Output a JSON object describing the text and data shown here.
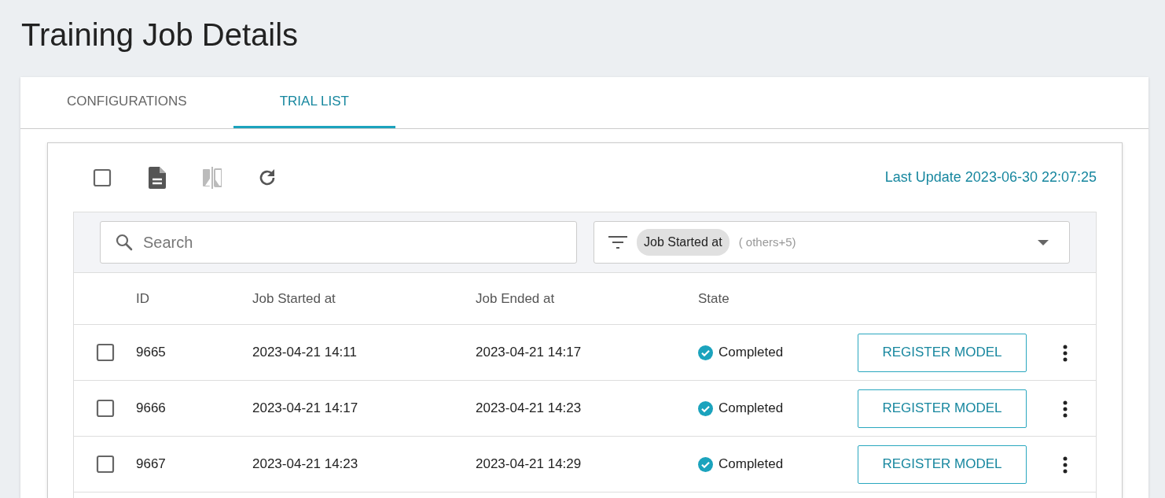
{
  "page": {
    "title": "Training Job Details"
  },
  "tabs": [
    {
      "label": "CONFIGURATIONS",
      "selected": false
    },
    {
      "label": "TRIAL LIST",
      "selected": true
    }
  ],
  "toolbar": [
    {
      "kind": "checkbox",
      "checked": false
    },
    {
      "kind": "document",
      "disabled": false
    },
    {
      "kind": "compare",
      "disabled": true
    },
    {
      "kind": "refresh",
      "disabled": false
    }
  ],
  "last_update": "Last Update 2023-06-30 22:07:25",
  "search": {
    "placeholder": "Search"
  },
  "filter": {
    "chip": "Job Started at",
    "others": "( others+5)"
  },
  "table": {
    "columns": [
      "ID",
      "Job Started at",
      "Job Ended at",
      "State"
    ],
    "rows": [
      {
        "checked": false,
        "id": "9665",
        "started": "2023-04-21 14:11",
        "ended": "2023-04-21 14:17",
        "state": "Completed",
        "action": "REGISTER MODEL"
      },
      {
        "checked": false,
        "id": "9666",
        "started": "2023-04-21 14:17",
        "ended": "2023-04-21 14:23",
        "state": "Completed",
        "action": "REGISTER MODEL"
      },
      {
        "checked": false,
        "id": "9667",
        "started": "2023-04-21 14:23",
        "ended": "2023-04-21 14:29",
        "state": "Completed",
        "action": "REGISTER MODEL"
      }
    ]
  }
}
